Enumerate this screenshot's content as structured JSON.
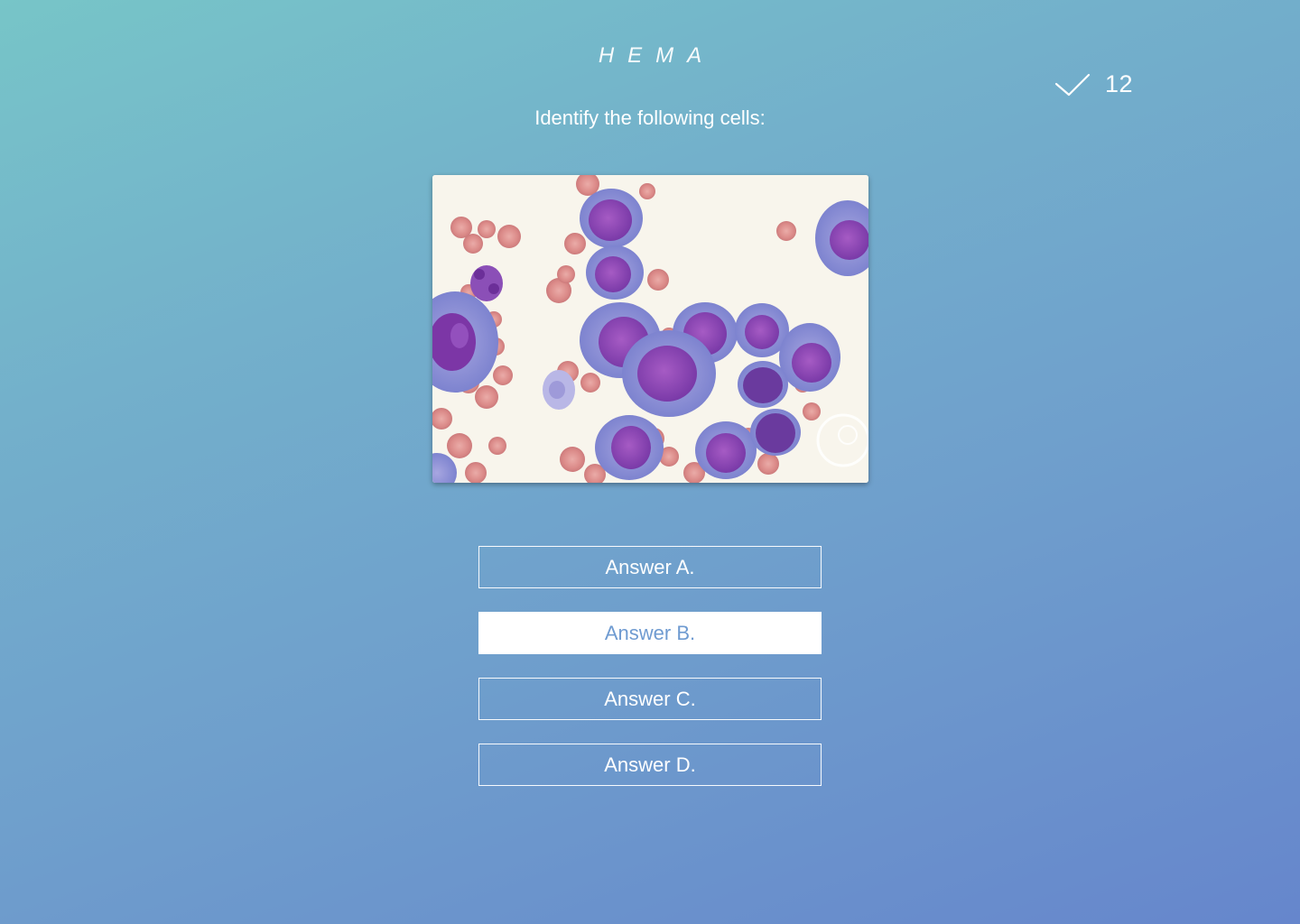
{
  "header": {
    "app_title": "HEMA"
  },
  "score": {
    "icon": "checkmark-icon",
    "value": "12"
  },
  "question": {
    "prompt": "Identify the following cells:",
    "image": "blood-smear-micrograph"
  },
  "answers": [
    {
      "label": "Answer A.",
      "selected": false
    },
    {
      "label": "Answer B.",
      "selected": true
    },
    {
      "label": "Answer C.",
      "selected": false
    },
    {
      "label": "Answer D.",
      "selected": false
    }
  ],
  "colors": {
    "gradient_start": "#77c5c8",
    "gradient_end": "#6686cc",
    "selected_text": "#6f9bd1",
    "text": "#ffffff"
  }
}
